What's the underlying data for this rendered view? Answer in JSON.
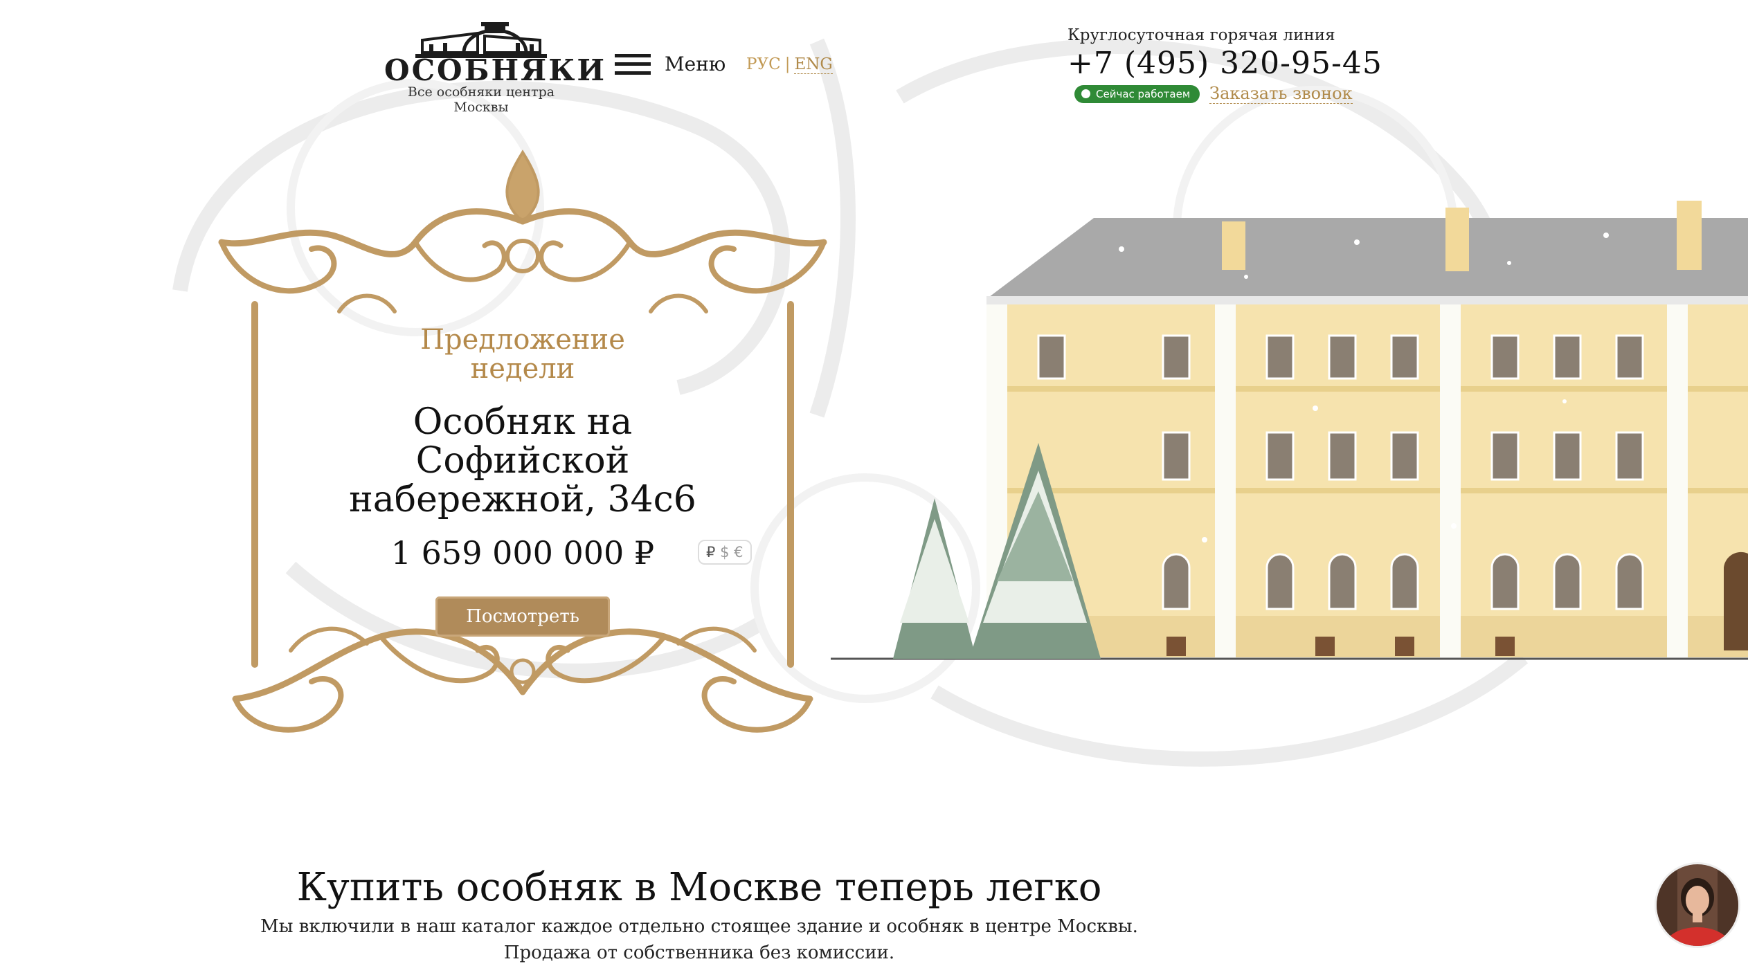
{
  "header": {
    "logo_text": "ОСОБНЯКИ",
    "logo_subtitle": "Все особняки центра Москвы",
    "menu_label": "Меню",
    "lang_current": "РУС",
    "lang_separator": "|",
    "lang_alt": "ENG",
    "hotline_label": "Круглосуточная горячая линия",
    "hotline_phone": "+7 (495) 320-95-45",
    "status_badge": "Сейчас работаем",
    "callback_label": "Заказать звонок"
  },
  "offer": {
    "kicker": "Предложение недели",
    "title": "Особняк на Софийской набережной, 34с6",
    "price": "1 659 000 000 ₽",
    "currencies": [
      "₽",
      "$",
      "€"
    ],
    "view_button": "Посмотреть"
  },
  "promo": {
    "headline": "Купить особняк в Москве теперь легко",
    "line1": "Мы включили в наш каталог каждое отдельно стоящее здание и особняк в центре Москвы.",
    "line2": "Продажа от собственника без комиссии."
  },
  "colors": {
    "gold": "#b08b5a",
    "status_green": "#2f8a36",
    "facade": "#f5e2ad",
    "roof": "#a8a8a8"
  },
  "icons": [
    "logo-building-icon",
    "hamburger-icon",
    "status-dot-icon",
    "ornament-frame-icon",
    "chat-avatar"
  ]
}
